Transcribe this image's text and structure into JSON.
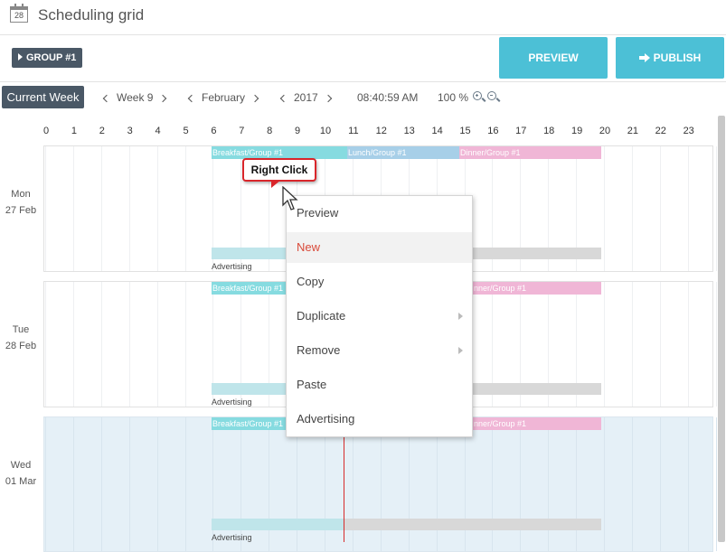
{
  "app": {
    "title": "Scheduling grid",
    "calendar_icon": "calendar-icon",
    "calendar_day": "28"
  },
  "toolbar": {
    "group_label": "GROUP #1",
    "preview_label": "PREVIEW",
    "publish_label": "PUBLISH",
    "accent": "#4cc0d6",
    "dark": "#4a5866"
  },
  "nav": {
    "current_week": "Current Week",
    "week": "Week 9",
    "month": "February",
    "year": "2017",
    "time": "08:40:59 AM",
    "zoom": "100 %"
  },
  "hours": [
    "0",
    "1",
    "2",
    "3",
    "4",
    "5",
    "6",
    "7",
    "8",
    "9",
    "10",
    "11",
    "12",
    "13",
    "14",
    "15",
    "16",
    "17",
    "18",
    "19",
    "20",
    "21",
    "22",
    "23"
  ],
  "days": [
    {
      "weekday": "Mon",
      "date": "27 Feb"
    },
    {
      "weekday": "Tue",
      "date": "28 Feb"
    },
    {
      "weekday": "Wed",
      "date": "01 Mar"
    }
  ],
  "events": {
    "breakfast": "Breakfast/Group #1",
    "lunch": "Lunch/Group #1",
    "dinner": "Dinner/Group #1",
    "dinner_partial": "nner/Group #1",
    "advertising": "Advertising"
  },
  "callout": {
    "text": "Right Click"
  },
  "context_menu": {
    "items": [
      {
        "label": "Preview",
        "submenu": false
      },
      {
        "label": "New",
        "submenu": false
      },
      {
        "label": "Copy",
        "submenu": false
      },
      {
        "label": "Duplicate",
        "submenu": true
      },
      {
        "label": "Remove",
        "submenu": true
      },
      {
        "label": "Paste",
        "submenu": false
      },
      {
        "label": "Advertising",
        "submenu": false
      }
    ],
    "highlight_color": "#d94a3a"
  }
}
